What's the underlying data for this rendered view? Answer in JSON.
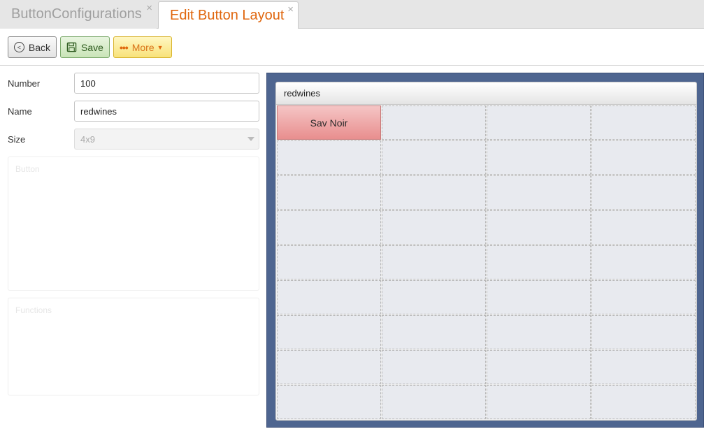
{
  "tabs": [
    {
      "label": "ButtonConfigurations",
      "active": false,
      "close": "×"
    },
    {
      "label": "Edit Button Layout",
      "active": true,
      "close": "×"
    }
  ],
  "toolbar": {
    "back_label": "Back",
    "save_label": "Save",
    "more_label": "More",
    "more_dots": "•••",
    "more_caret": "▼",
    "back_glyph": "<"
  },
  "form": {
    "number_label": "Number",
    "number_value": "100",
    "name_label": "Name",
    "name_value": "redwines",
    "size_label": "Size",
    "size_value": "4x9"
  },
  "panels": {
    "button_title": "Button",
    "functions_title": "Functions"
  },
  "layout": {
    "title": "redwines",
    "columns": 4,
    "rows": 9,
    "buttons": [
      {
        "row": 0,
        "col": 0,
        "label": "Sav Noir"
      }
    ]
  },
  "colors": {
    "accent": "#e0670f",
    "editor_bg": "#4e6590",
    "button_fill": "#e88e8e"
  }
}
